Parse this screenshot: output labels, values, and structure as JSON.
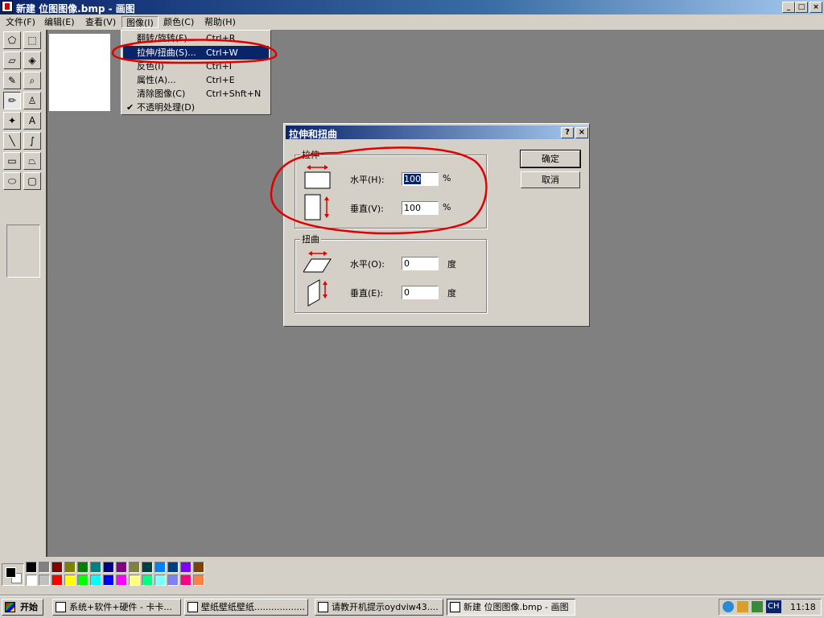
{
  "window": {
    "title": "新建 位图图像.bmp - 画图",
    "minimize": "_",
    "maximize": "□",
    "close": "×"
  },
  "menubar": [
    {
      "label": "文件(F)"
    },
    {
      "label": "编辑(E)"
    },
    {
      "label": "查看(V)"
    },
    {
      "label": "图像(I)"
    },
    {
      "label": "颜色(C)"
    },
    {
      "label": "帮助(H)"
    }
  ],
  "image_menu": {
    "items": [
      {
        "label": "翻转/旋转(F)...",
        "shortcut": "Ctrl+R",
        "selected": false,
        "checked": false
      },
      {
        "label": "拉伸/扭曲(S)...",
        "shortcut": "Ctrl+W",
        "selected": true,
        "checked": false
      },
      {
        "label": "反色(I)",
        "shortcut": "Ctrl+I",
        "selected": false,
        "checked": false
      },
      {
        "label": "属性(A)...",
        "shortcut": "Ctrl+E",
        "selected": false,
        "checked": false
      },
      {
        "label": "清除图像(C)",
        "shortcut": "Ctrl+Shft+N",
        "selected": false,
        "checked": false
      },
      {
        "label": "不透明处理(D)",
        "shortcut": "",
        "selected": false,
        "checked": true
      }
    ],
    "check_mark": "✔"
  },
  "toolbox": {
    "tools": [
      {
        "name": "free-select-icon",
        "glyph": "⬠"
      },
      {
        "name": "rect-select-icon",
        "glyph": "⬚"
      },
      {
        "name": "eraser-icon",
        "glyph": "▱"
      },
      {
        "name": "fill-icon",
        "glyph": "◈"
      },
      {
        "name": "color-picker-icon",
        "glyph": "✎"
      },
      {
        "name": "magnifier-icon",
        "glyph": "⌕"
      },
      {
        "name": "pencil-icon",
        "glyph": "✏"
      },
      {
        "name": "brush-icon",
        "glyph": "♙"
      },
      {
        "name": "airbrush-icon",
        "glyph": "✦"
      },
      {
        "name": "text-icon",
        "glyph": "A"
      },
      {
        "name": "line-icon",
        "glyph": "╲"
      },
      {
        "name": "curve-icon",
        "glyph": "∫"
      },
      {
        "name": "rectangle-icon",
        "glyph": "▭"
      },
      {
        "name": "polygon-icon",
        "glyph": "⏢"
      },
      {
        "name": "ellipse-icon",
        "glyph": "⬭"
      },
      {
        "name": "rounded-rect-icon",
        "glyph": "▢"
      }
    ],
    "active_tool": "pencil-icon"
  },
  "dialog": {
    "title": "拉伸和扭曲",
    "help": "?",
    "close": "×",
    "stretch": {
      "group_label": "拉伸",
      "horizontal_label": "水平(H):",
      "horizontal_value": "100",
      "horizontal_unit": "%",
      "vertical_label": "垂直(V):",
      "vertical_value": "100",
      "vertical_unit": "%"
    },
    "skew": {
      "group_label": "扭曲",
      "horizontal_label": "水平(O):",
      "horizontal_value": "0",
      "horizontal_unit": "度",
      "vertical_label": "垂直(E):",
      "vertical_value": "0",
      "vertical_unit": "度"
    },
    "ok_label": "确定",
    "cancel_label": "取消"
  },
  "palette": {
    "foreground": "#000000",
    "background": "#ffffff",
    "colors_top": [
      "#000000",
      "#808080",
      "#800000",
      "#808000",
      "#008000",
      "#008080",
      "#000080",
      "#800080",
      "#808040",
      "#004040",
      "#0080ff",
      "#004080",
      "#8000ff",
      "#804000"
    ],
    "colors_bottom": [
      "#ffffff",
      "#c0c0c0",
      "#ff0000",
      "#ffff00",
      "#00ff00",
      "#00ffff",
      "#0000ff",
      "#ff00ff",
      "#ffff80",
      "#00ff80",
      "#80ffff",
      "#8080ff",
      "#ff0080",
      "#ff8040"
    ]
  },
  "taskbar": {
    "start_label": "开始",
    "tasks": [
      {
        "label": "系统+软件+硬件 - 卡卡...",
        "active": false
      },
      {
        "label": "壁纸壁纸壁纸..................",
        "active": false
      },
      {
        "label": "请教开机提示oydviw43....",
        "active": false
      },
      {
        "label": "新建 位图图像.bmp - 画图",
        "active": true
      }
    ],
    "ime": "CH",
    "clock": "11:18"
  },
  "colors": {
    "annotation": "#e00000",
    "selection": "#0a246a"
  }
}
